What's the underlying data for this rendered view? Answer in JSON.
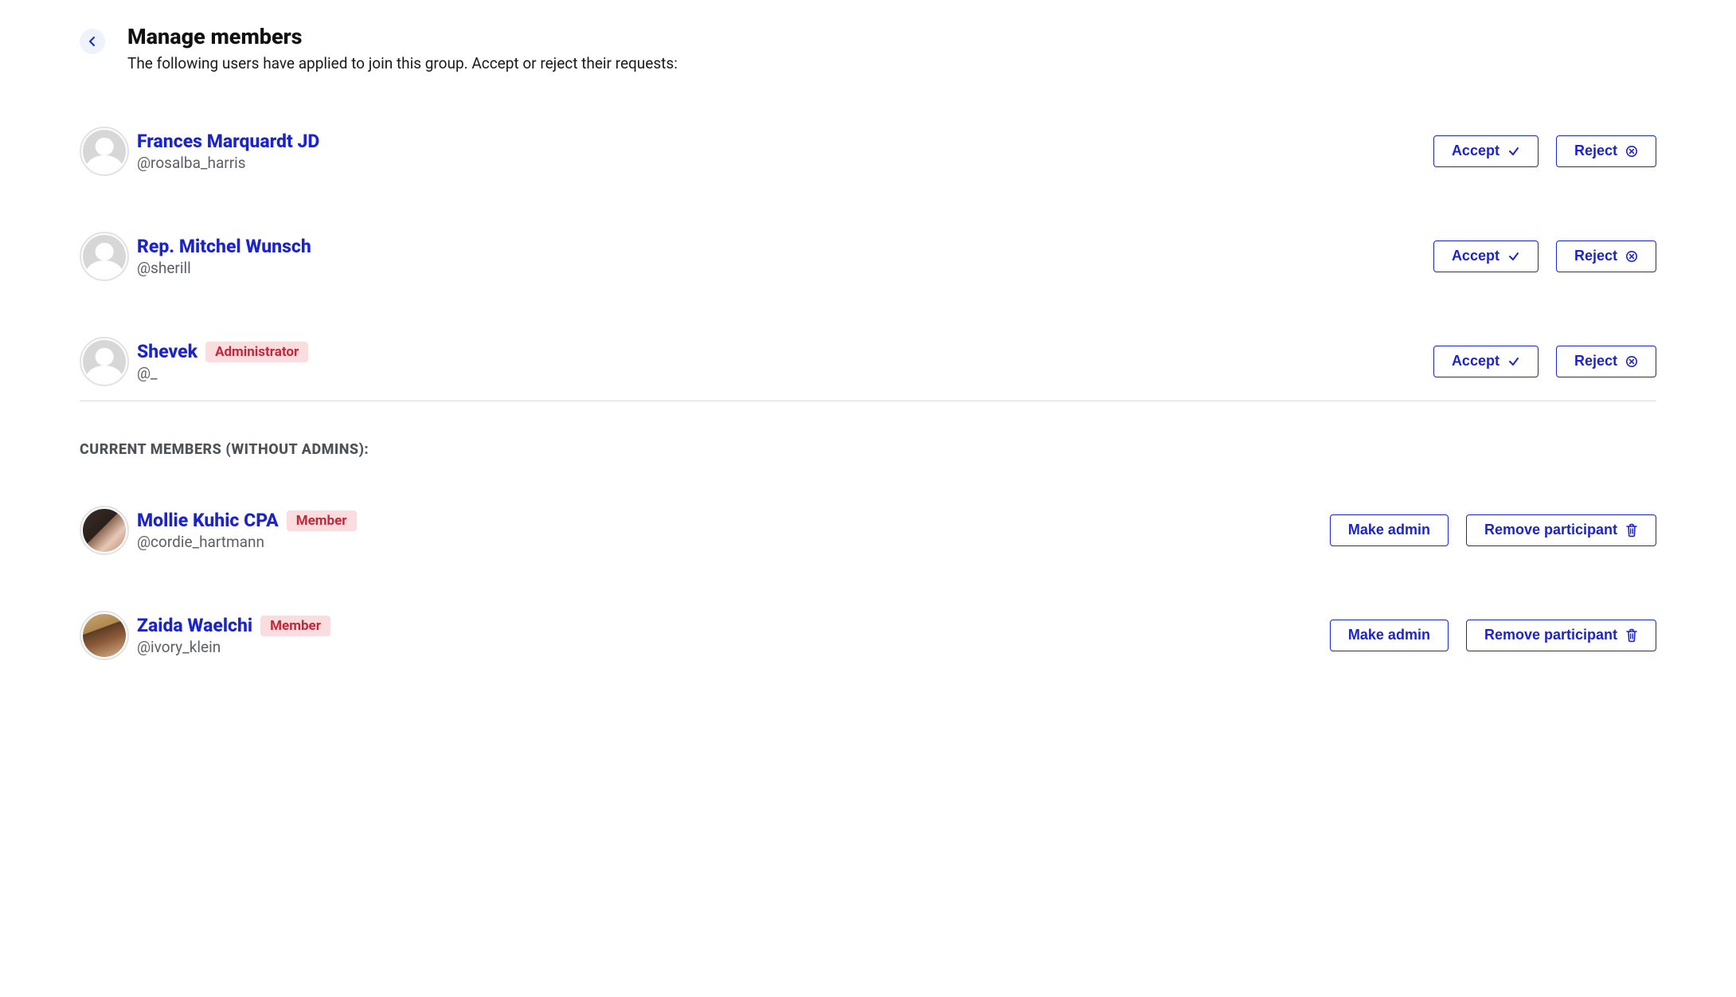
{
  "header": {
    "title": "Manage members",
    "subtitle": "The following users have applied to join this group. Accept or reject their requests:"
  },
  "buttons": {
    "accept": "Accept",
    "reject": "Reject",
    "make_admin": "Make admin",
    "remove_participant": "Remove participant"
  },
  "badges": {
    "administrator": "Administrator",
    "member": "Member"
  },
  "section": {
    "current_members_heading": "CURRENT MEMBERS (WITHOUT ADMINS):"
  },
  "applicants": [
    {
      "name": "Frances Marquardt JD",
      "handle": "@rosalba_harris",
      "badge": null,
      "avatar": "placeholder"
    },
    {
      "name": "Rep. Mitchel Wunsch",
      "handle": "@sherill",
      "badge": null,
      "avatar": "placeholder"
    },
    {
      "name": "Shevek",
      "handle": "@_",
      "badge": "administrator",
      "avatar": "placeholder"
    }
  ],
  "members": [
    {
      "name": "Mollie Kuhic CPA",
      "handle": "@cordie_hartmann",
      "badge": "member",
      "avatar": "photo-a"
    },
    {
      "name": "Zaida Waelchi",
      "handle": "@ivory_klein",
      "badge": "member",
      "avatar": "photo-b"
    }
  ]
}
